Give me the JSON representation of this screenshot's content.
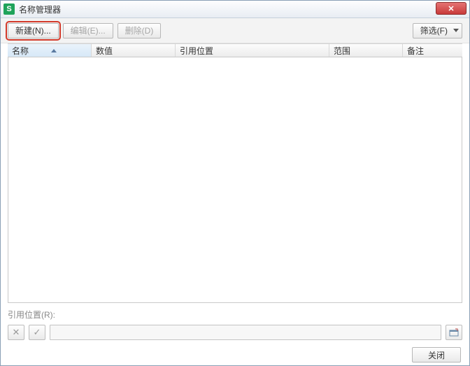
{
  "titlebar": {
    "title": "名称管理器",
    "app_icon_letter": "S"
  },
  "toolbar": {
    "new_label": "新建(N)...",
    "edit_label": "编辑(E)...",
    "delete_label": "删除(D)",
    "filter_label": "筛选(F)"
  },
  "columns": {
    "name": "名称",
    "value": "数值",
    "reference": "引用位置",
    "scope": "范围",
    "note": "备注"
  },
  "reference_section": {
    "label": "引用位置(R):"
  },
  "footer": {
    "close_label": "关闭"
  },
  "rows": []
}
